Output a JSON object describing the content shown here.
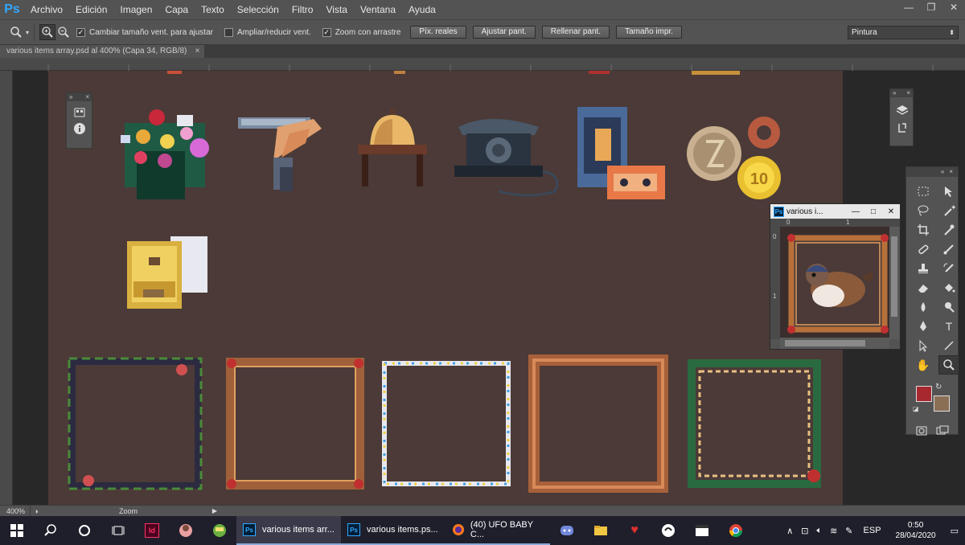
{
  "app": {
    "logo": "Ps"
  },
  "menu": [
    "Archivo",
    "Edición",
    "Imagen",
    "Capa",
    "Texto",
    "Selección",
    "Filtro",
    "Vista",
    "Ventana",
    "Ayuda"
  ],
  "window_controls": {
    "minimize": "—",
    "restore": "❐",
    "close": "✕"
  },
  "options": {
    "resize_windows": "Cambiar tamaño vent. para ajustar",
    "zoom_all_windows": "Ampliar/reducir vent.",
    "scrubby_zoom": "Zoom con arrastre",
    "btn_actual_pixels": "Píx. reales",
    "btn_fit_screen": "Ajustar pant.",
    "btn_fill_screen": "Rellenar pant.",
    "btn_print_size": "Tamaño impr.",
    "workspace": "Pintura"
  },
  "document": {
    "tab_title": "various items array.psd al 400% (Capa 34, RGB/8)",
    "tab_close": "×"
  },
  "subwindow": {
    "title": "various i...",
    "ruler_0": "0",
    "ruler_1": "1",
    "ruler_v0": "0",
    "ruler_v1": "1"
  },
  "status": {
    "zoom": "400%",
    "label": "Zoom"
  },
  "taskbar": {
    "apps": [
      {
        "label": "various items arr...",
        "icon": "Ps"
      },
      {
        "label": "various items.ps...",
        "icon": "Ps"
      },
      {
        "label": "(40) UFO BABY C...",
        "icon": "firefox-icon"
      }
    ],
    "lang": "ESP",
    "time": "0:50",
    "date": "28/04/2020"
  },
  "colors": {
    "foreground": "#a8282f",
    "background": "#8b6f55",
    "canvas": "#4b3a37",
    "ps_blue": "#31a8ff"
  }
}
